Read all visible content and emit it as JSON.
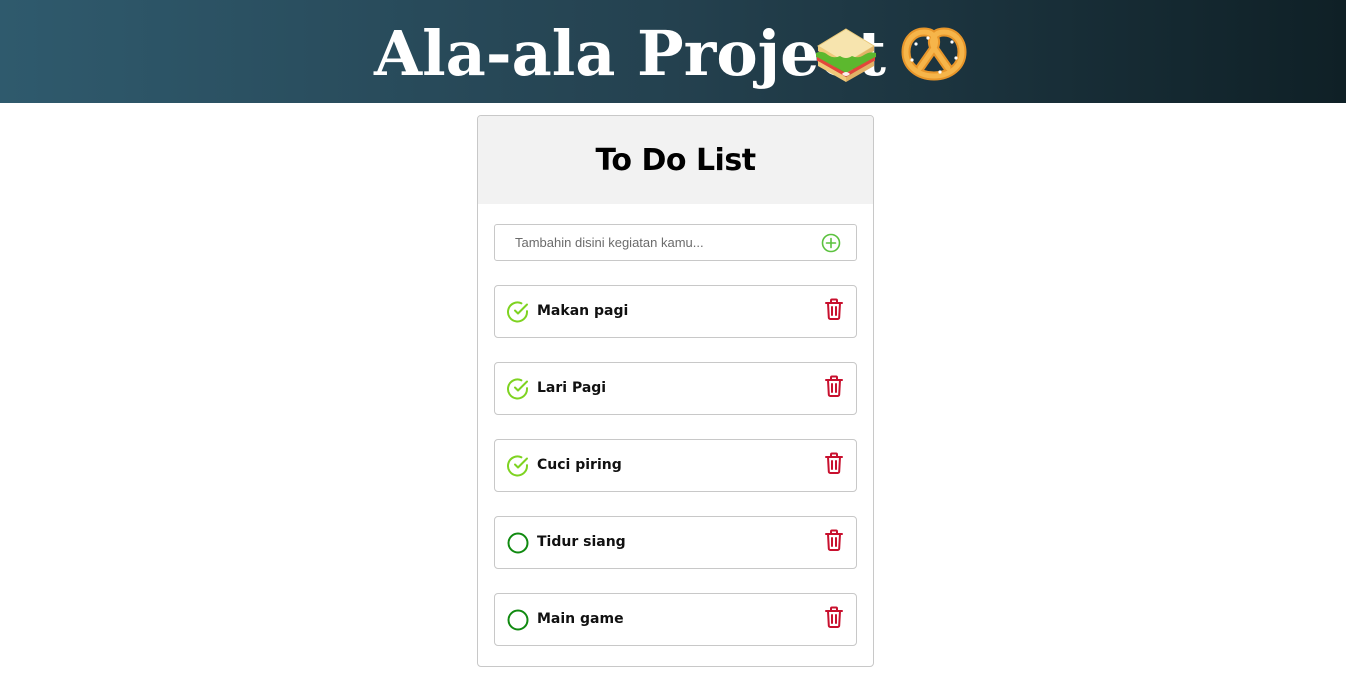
{
  "banner": {
    "title": "Ala-ala Project",
    "emoji_icons": [
      "sandwich-icon",
      "pretzel-icon"
    ]
  },
  "todo": {
    "title": "To Do List",
    "input": {
      "placeholder": "Tambahin disini kegiatan kamu...",
      "value": "",
      "add_icon": "plus-circle-icon"
    },
    "items": [
      {
        "label": "Makan pagi",
        "done": true
      },
      {
        "label": "Lari Pagi",
        "done": true
      },
      {
        "label": "Cuci piring",
        "done": true
      },
      {
        "label": "Tidur siang",
        "done": false
      },
      {
        "label": "Main game",
        "done": false
      }
    ],
    "delete_icon": "trash-icon"
  },
  "colors": {
    "banner_start": "#2f5a6d",
    "banner_end": "#0f2026",
    "done_check": "#7ed321",
    "undone_circle": "#108a10",
    "add_icon": "#5cc23f",
    "delete_icon": "#c8102e",
    "header_bg": "#f2f2f2"
  }
}
